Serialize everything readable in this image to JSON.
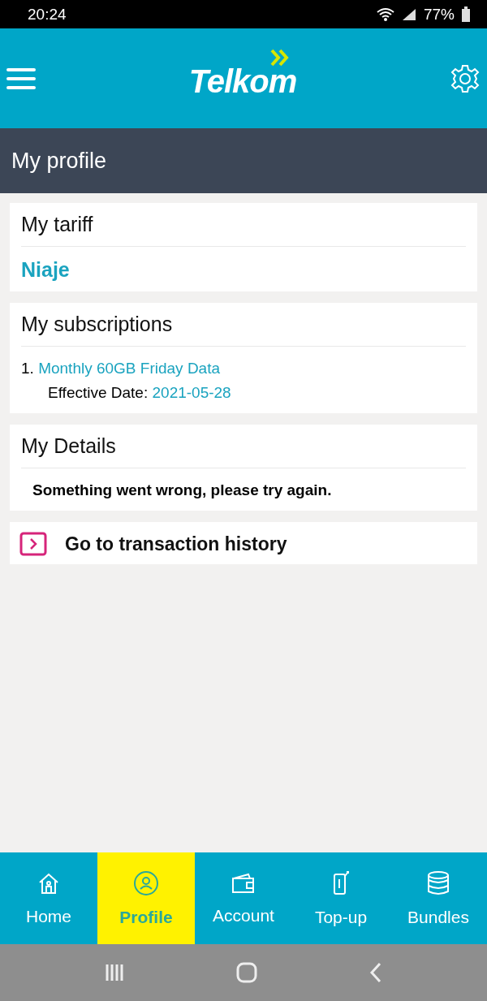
{
  "status_bar": {
    "time": "20:24",
    "battery": "77%"
  },
  "header": {
    "logo": "Telkom"
  },
  "page_title": "My profile",
  "tariff": {
    "title": "My tariff",
    "name": "Niaje"
  },
  "subscriptions": {
    "title": "My subscriptions",
    "items": [
      {
        "number": "1.",
        "name": "Monthly 60GB Friday Data",
        "date_label": "Effective Date:",
        "date": "2021-05-28"
      }
    ]
  },
  "details": {
    "title": "My Details",
    "message": "Something went wrong, please try again."
  },
  "transaction_link": "Go to transaction history",
  "bottom_nav": [
    {
      "label": "Home",
      "kind": "home",
      "selected": false
    },
    {
      "label": "Profile",
      "kind": "profile",
      "selected": true
    },
    {
      "label": "Account",
      "kind": "wallet",
      "selected": false
    },
    {
      "label": "Top-up",
      "kind": "topup",
      "selected": false
    },
    {
      "label": "Bundles",
      "kind": "bundles",
      "selected": false
    }
  ]
}
